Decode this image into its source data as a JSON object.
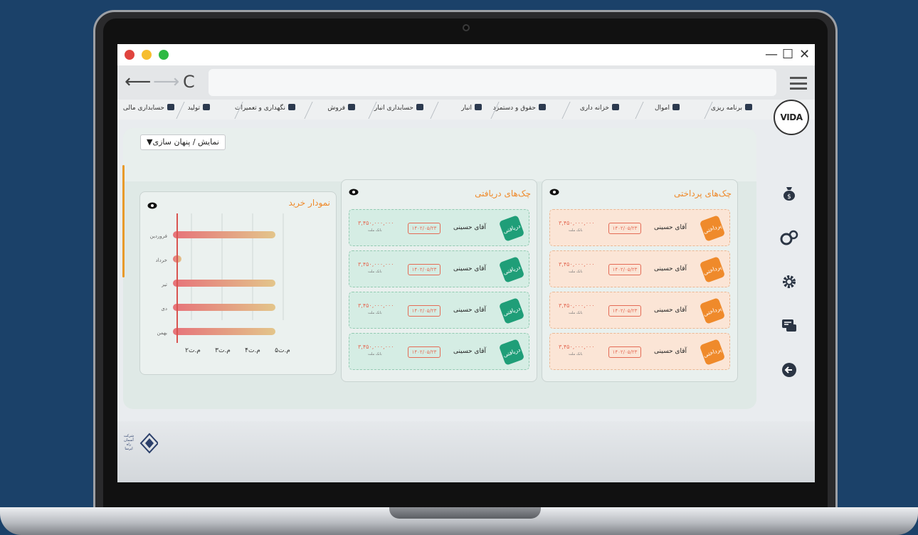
{
  "window": {
    "traffic_lights": [
      "#e0443e",
      "#f6be2f",
      "#2fb944"
    ],
    "controls": {
      "minimize": "—",
      "maximize": "☐",
      "close": "✕"
    }
  },
  "nav": {
    "back": "⟵",
    "forward": "⟶",
    "reload": "C"
  },
  "logo": {
    "text": "VIDA"
  },
  "menu": [
    {
      "label": "برنامه ریزی",
      "icon": "pie-chart-icon"
    },
    {
      "label": "اموال",
      "icon": "document-icon"
    },
    {
      "label": "خزانه داری",
      "icon": "coins-icon"
    },
    {
      "label": "حقوق و دستمزد",
      "icon": "people-icon"
    },
    {
      "label": "انبار",
      "icon": "people-icon"
    },
    {
      "label": "حسابداری انبار",
      "icon": "people-icon"
    },
    {
      "label": "فروش",
      "icon": "bar-chart-icon"
    },
    {
      "label": "نگهداری و تعمیرات",
      "icon": "tools-icon"
    },
    {
      "label": "تولید",
      "icon": "tag-icon"
    },
    {
      "label": "حسابداری مالی",
      "icon": "heart-icon"
    }
  ],
  "sidebar_icons": [
    "money-bag-icon",
    "coins-gear-icon",
    "gear-icon",
    "chat-icon",
    "exit-icon"
  ],
  "toggle": {
    "label": "نمایش / پنهان سازی▼"
  },
  "payment_panel": {
    "title": "چک‌های پرداختی",
    "tag": "پرداختی",
    "accent": "#ef8a2b",
    "rows": [
      {
        "name": "آقای حسینی",
        "date": "۱۴۰۲/۰۵/۲۳",
        "amount": "۳,۴۵۰,۰۰۰,۰۰۰",
        "bank": "بانک ملت"
      },
      {
        "name": "آقای حسینی",
        "date": "۱۴۰۲/۰۵/۲۳",
        "amount": "۳,۴۵۰,۰۰۰,۰۰۰",
        "bank": "بانک ملت"
      },
      {
        "name": "آقای حسینی",
        "date": "۱۴۰۲/۰۵/۲۳",
        "amount": "۳,۴۵۰,۰۰۰,۰۰۰",
        "bank": "بانک ملت"
      },
      {
        "name": "آقای حسینی",
        "date": "۱۴۰۲/۰۵/۲۳",
        "amount": "۳,۴۵۰,۰۰۰,۰۰۰",
        "bank": "بانک ملت"
      }
    ]
  },
  "receive_panel": {
    "title": "چک‌های دریافتی",
    "tag": "دریافتی",
    "accent": "#1f9e78",
    "rows": [
      {
        "name": "آقای حسینی",
        "date": "۱۴۰۲/۰۵/۲۳",
        "amount": "۳,۴۵۰,۰۰۰,۰۰۰",
        "bank": "بانک ملت"
      },
      {
        "name": "آقای حسینی",
        "date": "۱۴۰۲/۰۵/۲۳",
        "amount": "۳,۴۵۰,۰۰۰,۰۰۰",
        "bank": "بانک ملت"
      },
      {
        "name": "آقای حسینی",
        "date": "۱۴۰۲/۰۵/۲۳",
        "amount": "۳,۴۵۰,۰۰۰,۰۰۰",
        "bank": "بانک ملت"
      },
      {
        "name": "آقای حسینی",
        "date": "۱۴۰۲/۰۵/۲۳",
        "amount": "۳,۴۵۰,۰۰۰,۰۰۰",
        "bank": "بانک ملت"
      }
    ]
  },
  "chart_data": {
    "type": "bar",
    "orientation": "horizontal",
    "title": "نمودار خرید",
    "categories": [
      "فروردین",
      "خرداد",
      "تیر",
      "دی",
      "بهمن"
    ],
    "values": [
      5.0,
      1.7,
      5.0,
      5.0,
      5.0
    ],
    "x_tick_labels": [
      "۵م.ت",
      "۴م.ت",
      "۳م.ت",
      "۲م.ت"
    ],
    "xlim": [
      1.6,
      5.0
    ],
    "grid": true,
    "colors": {
      "start": "#e6737a",
      "end": "#e3c58a"
    }
  },
  "footer": {
    "company": "شرکت آسمان راه ایرسا"
  }
}
